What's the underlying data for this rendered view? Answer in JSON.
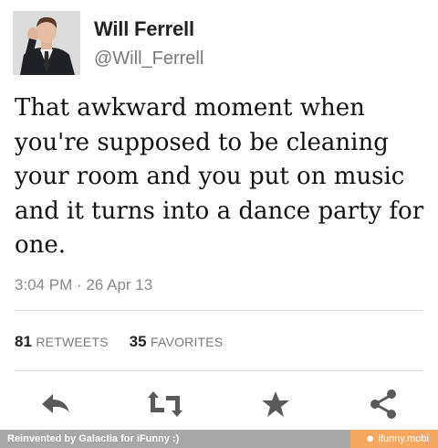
{
  "user": {
    "display_name": "Will Ferrell",
    "handle": "@Will_Ferrell"
  },
  "tweet": {
    "lines": [
      "That awkward moment when",
      "you're supposed to be cleaning",
      "your room and you put on music",
      "and it turns into a dance party for",
      "one."
    ],
    "timestamp": "3:04 PM · 26 Apr 13"
  },
  "stats": {
    "retweets_count": "81",
    "retweets_label": "RETWEETS",
    "favorites_count": "35",
    "favorites_label": "FAVORITES"
  },
  "actions": {
    "icons": [
      "reply-icon",
      "retweet-icon",
      "favorite-star-icon",
      "share-icon"
    ],
    "icon_color": "#5a5a5a"
  },
  "footer": {
    "left_text": "Reinvented by Galactia for iFunny :)",
    "right_text": "☻ ifunny.mobi",
    "left_bg": "#a7a7a7",
    "right_bg": "#f5a862"
  }
}
